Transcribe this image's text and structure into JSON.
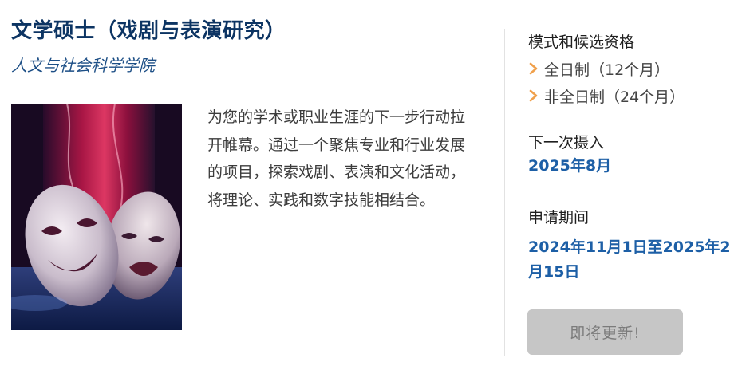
{
  "course": {
    "title": "文学硕士（戏剧与表演研究）",
    "faculty": "人文与社会科学学院",
    "description": "为您的学术或职业生涯的下一步行动拉开帷幕。通过一个聚焦专业和行业发展的项目，探索戏剧、表演和文化活动，将理论、实践和数字技能相结合。"
  },
  "sidebar": {
    "mode_label": "模式和候选资格",
    "modes": [
      {
        "label": "全日制（12个月）"
      },
      {
        "label": "非全日制（24个月）"
      }
    ],
    "intake_label": "下一次摄入",
    "intake_value": "2025年8月",
    "application_label": "申请期间",
    "application_value": "2024年11月1日至2025年2月15日",
    "button_label": "即将更新!"
  },
  "colors": {
    "title": "#0c3463",
    "accent_blue": "#1d5fa6",
    "chevron": "#f0a04b",
    "button_bg": "#c6c6c6"
  },
  "icons": {
    "bullet": "chevron-right-icon"
  }
}
